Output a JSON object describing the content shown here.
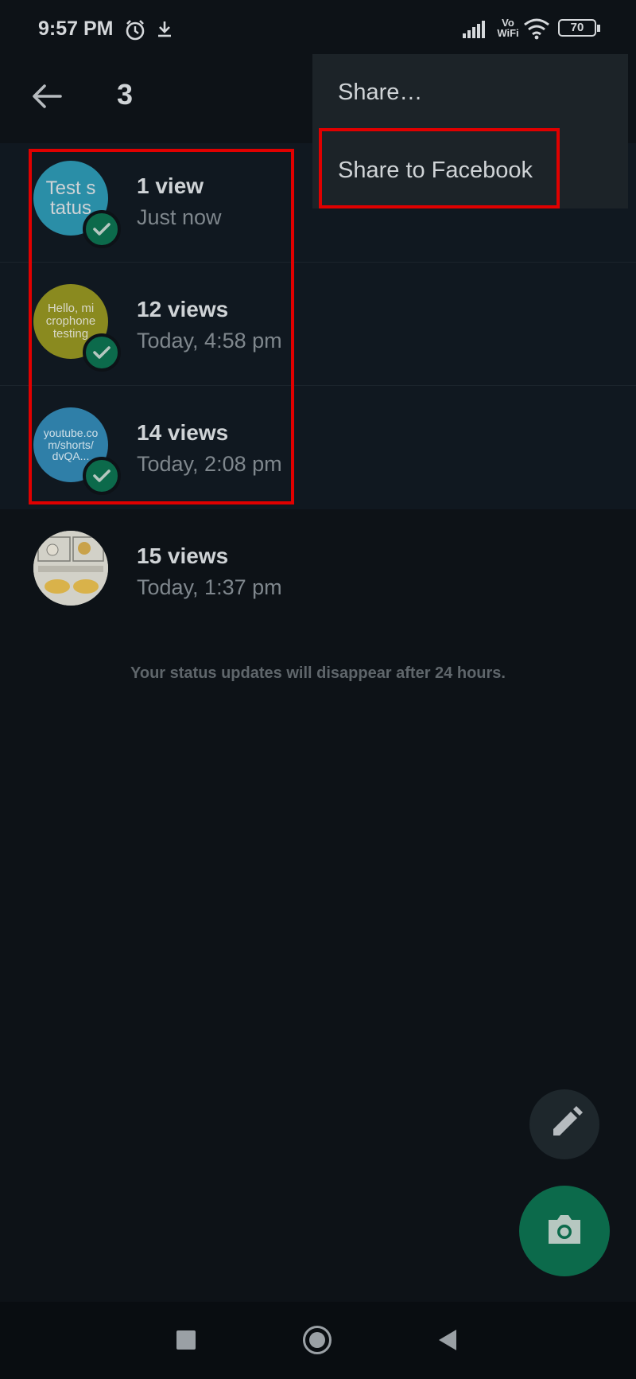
{
  "status_bar": {
    "time": "9:57 PM",
    "battery": "70",
    "volte": "Vo",
    "wifi_label": "WiFi",
    "icons": [
      "alarm-icon",
      "download-icon",
      "signal-icon",
      "volte-wifi-icon",
      "wifi-icon",
      "battery-icon"
    ]
  },
  "app_bar": {
    "title": "3",
    "back_icon": "arrow-left-icon"
  },
  "menu": {
    "items": [
      "Share…",
      "Share to Facebook"
    ]
  },
  "statuses": [
    {
      "thumb_text": "Test s tatus",
      "thumb_color": "#2a8ea7",
      "views": "1 view",
      "time": "Just now",
      "selected": true
    },
    {
      "thumb_text": "Hello, mi crophone testing",
      "thumb_color": "#8a8a1f",
      "views": "12 views",
      "time": "Today, 4:58 pm",
      "selected": true
    },
    {
      "thumb_text": "youtube.co m/shorts/ dvQA...",
      "thumb_color": "#2f7fa8",
      "views": "14 views",
      "time": "Today, 2:08 pm",
      "selected": true
    },
    {
      "thumb_text": "",
      "thumb_color": "#cfcfc6",
      "views": "15 views",
      "time": "Today, 1:37 pm",
      "selected": false
    }
  ],
  "footnote": "Your status updates will disappear after 24 hours.",
  "fabs": {
    "edit_icon": "pencil-icon",
    "camera_icon": "camera-icon"
  },
  "nav_bar": {
    "icons": [
      "recents-square-icon",
      "home-circle-icon",
      "back-triangle-icon"
    ]
  },
  "colors": {
    "accent": "#0c6a4b",
    "highlight": "#e00000",
    "background": "#0d1217"
  }
}
